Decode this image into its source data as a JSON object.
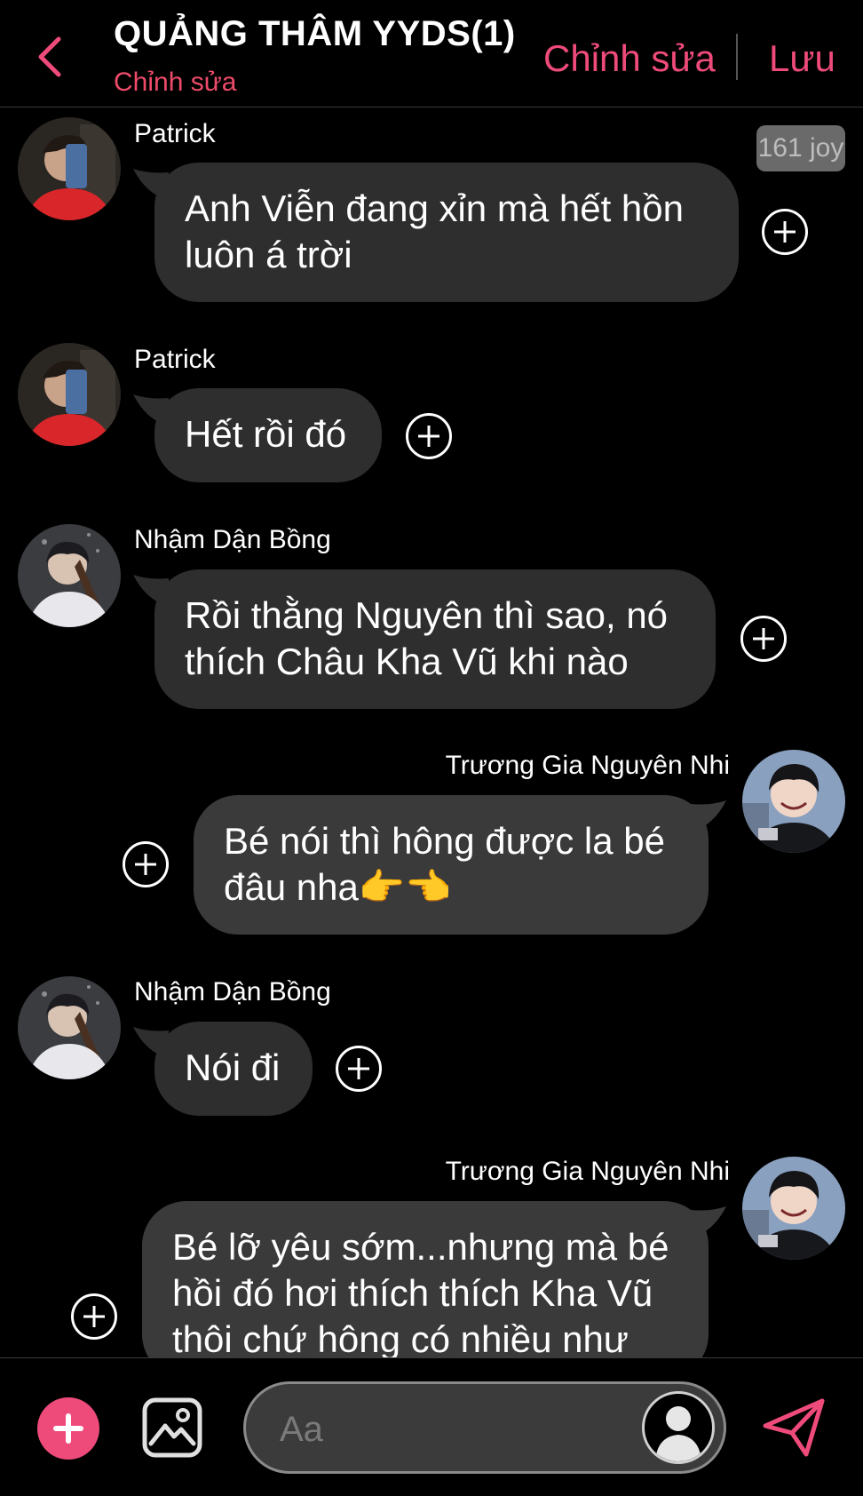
{
  "header": {
    "back_icon": "chevron-left-icon",
    "title": "QUẢNG THÂM YYDS(1)",
    "subtitle": "Chỉnh sửa",
    "edit_label": "Chỉnh sửa",
    "save_label": "Lưu",
    "accent_color": "#ee4b7a"
  },
  "joy_badge": "161 joy",
  "messages": [
    {
      "sender": "Patrick",
      "side": "in",
      "text_lines": [
        "Anh Viễn đang xỉn mà hết hồn",
        "luôn á trời"
      ]
    },
    {
      "sender": "Patrick",
      "side": "in",
      "text_lines": [
        "Hết rồi đó"
      ]
    },
    {
      "sender": "Nhậm Dận Bồng",
      "side": "in",
      "text_lines": [
        "Rồi thằng Nguyên thì sao, nó",
        "thích Châu Kha Vũ khi nào"
      ]
    },
    {
      "sender": "Trương Gia Nguyên Nhi",
      "side": "out",
      "text_lines": [
        "Bé nói thì hông được la bé",
        "đâu nha👉👈"
      ]
    },
    {
      "sender": "Nhậm Dận Bồng",
      "side": "in",
      "text_lines": [
        "Nói đi"
      ]
    },
    {
      "sender": "Trương Gia Nguyên Nhi",
      "side": "out",
      "text_lines": [
        "Bé lỡ yêu sớm...nhưng mà bé",
        "hồi đó hơi thích thích Kha Vũ",
        "thôi chứ hông có nhiều như"
      ]
    }
  ],
  "composer": {
    "placeholder": "Aa",
    "add_icon": "plus-icon",
    "image_icon": "image-icon",
    "avatar_icon": "user-silhouette-icon",
    "send_icon": "send-icon"
  },
  "colors": {
    "background": "#000000",
    "bubble_in": "#2e2e2e",
    "bubble_out": "#3a3a3a"
  }
}
